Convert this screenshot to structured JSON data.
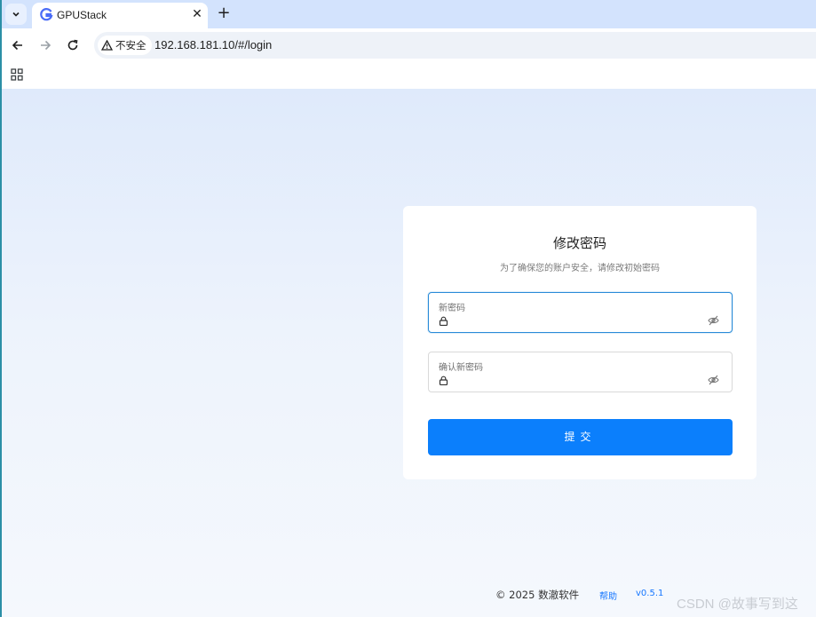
{
  "browser": {
    "tab": {
      "title": "GPUStack"
    },
    "address": {
      "security_label": "不安全",
      "url": "192.168.181.10/#/login"
    }
  },
  "card": {
    "title": "修改密码",
    "subtitle": "为了确保您的账户安全，请修改初始密码",
    "new_password": {
      "label": "新密码",
      "value": ""
    },
    "confirm_password": {
      "label": "确认新密码",
      "value": ""
    },
    "submit_label": "提交"
  },
  "footer": {
    "copyright": "© 2025 数澈软件",
    "help": "帮助",
    "version": "v0.5.1"
  },
  "watermark": "CSDN @故事写到这",
  "colors": {
    "accent": "#0b7ffc",
    "focus_border": "#2a8bd8",
    "link": "#1677ff"
  }
}
